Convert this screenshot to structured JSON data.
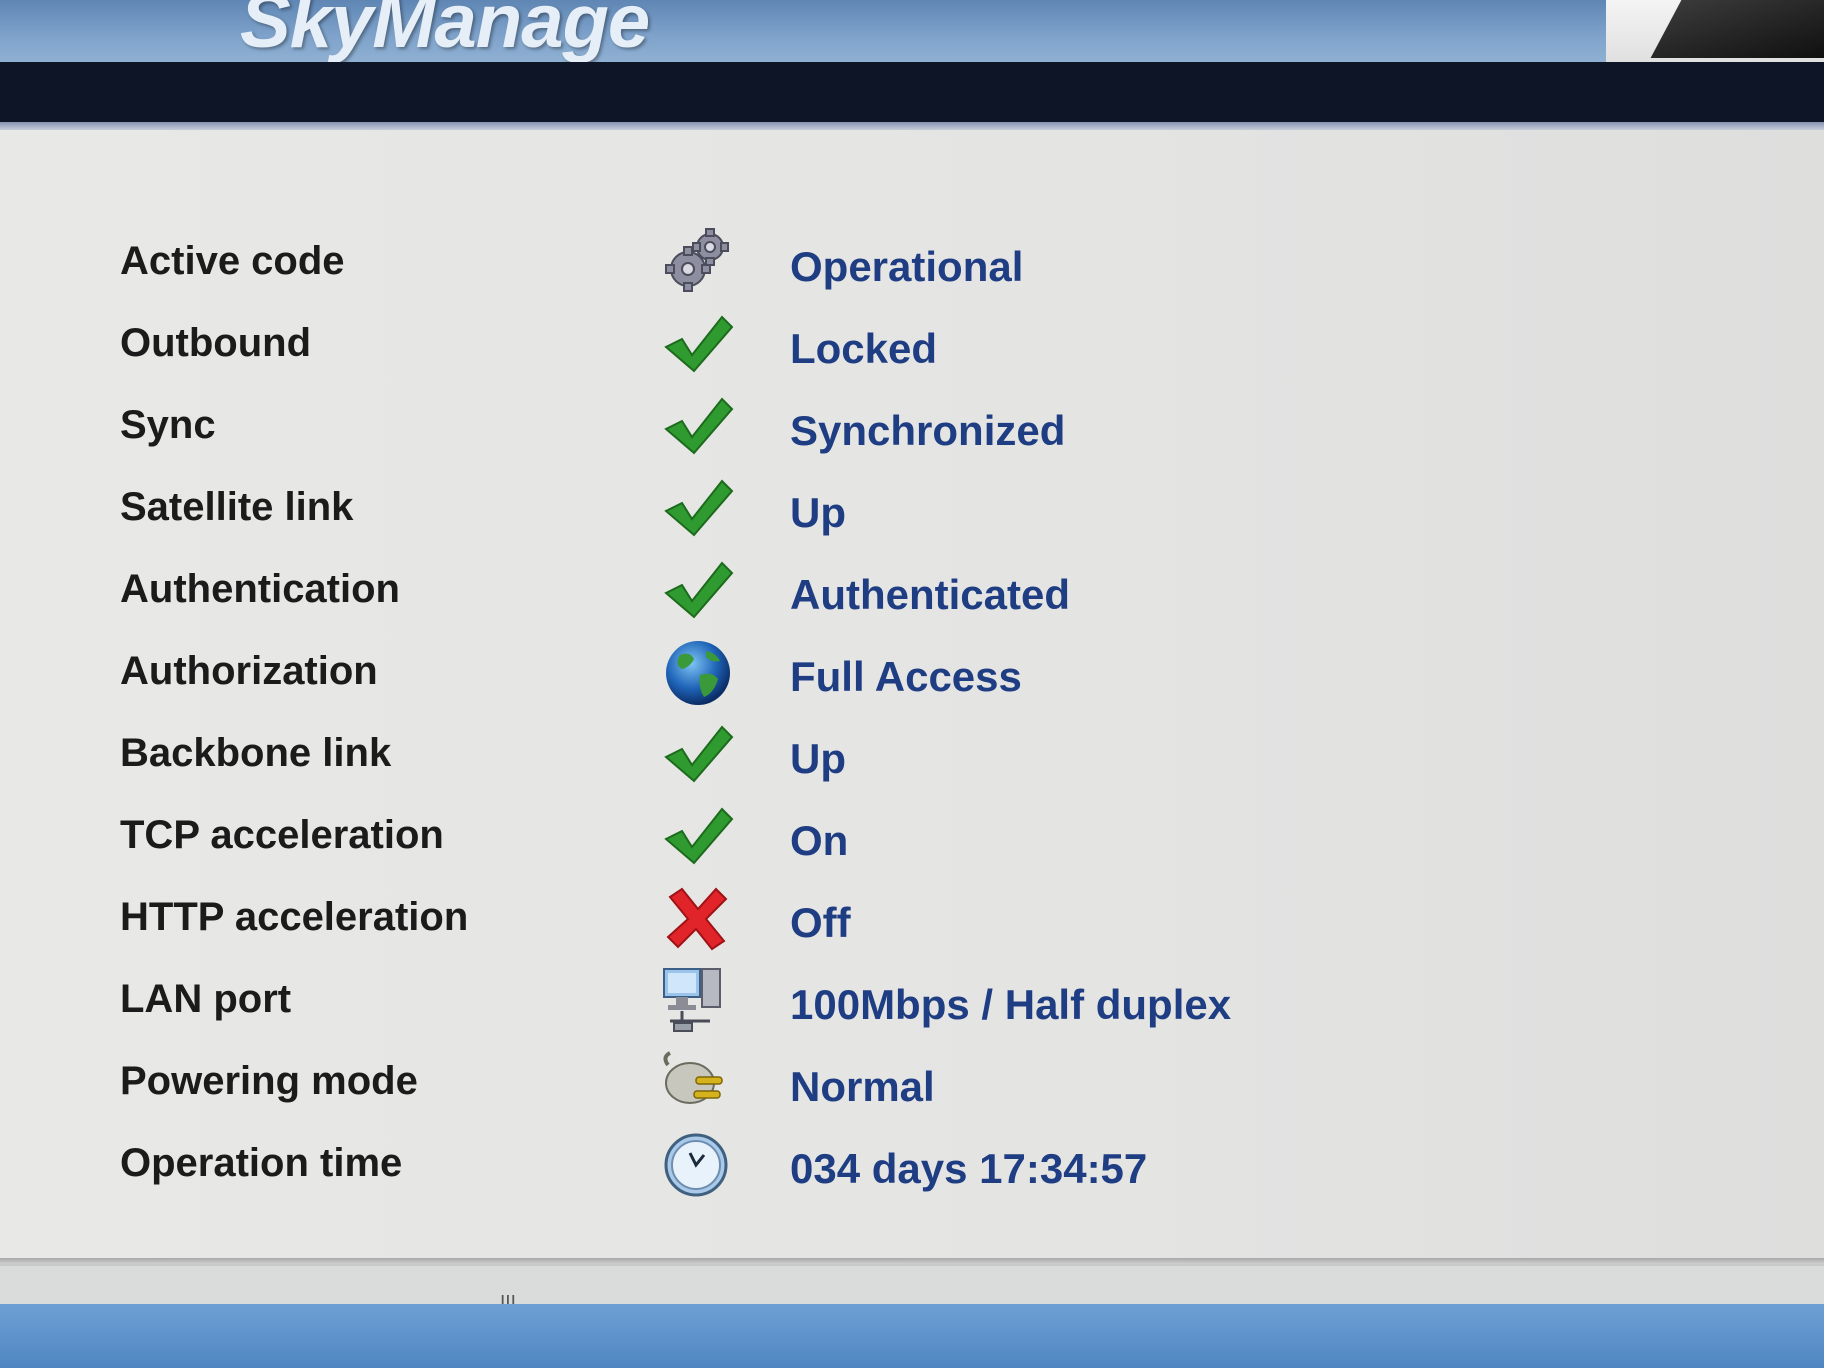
{
  "header": {
    "logo_text": "SkyManage"
  },
  "status_rows": [
    {
      "label": "Active code",
      "icon": "gears-icon",
      "value": "Operational"
    },
    {
      "label": "Outbound",
      "icon": "check-icon",
      "value": "Locked"
    },
    {
      "label": "Sync",
      "icon": "check-icon",
      "value": "Synchronized"
    },
    {
      "label": "Satellite link",
      "icon": "check-icon",
      "value": "Up"
    },
    {
      "label": "Authentication",
      "icon": "check-icon",
      "value": "Authenticated"
    },
    {
      "label": "Authorization",
      "icon": "globe-icon",
      "value": "Full Access"
    },
    {
      "label": "Backbone link",
      "icon": "check-icon",
      "value": "Up"
    },
    {
      "label": "TCP acceleration",
      "icon": "check-icon",
      "value": "On"
    },
    {
      "label": "HTTP acceleration",
      "icon": "cross-icon",
      "value": "Off"
    },
    {
      "label": "LAN port",
      "icon": "network-computer-icon",
      "value": "100Mbps / Half duplex"
    },
    {
      "label": "Powering mode",
      "icon": "power-plug-icon",
      "value": "Normal"
    },
    {
      "label": "Operation time",
      "icon": "clock-icon",
      "value": "034 days 17:34:57"
    }
  ],
  "colors": {
    "value_text": "#1f3d83",
    "label_text": "#1b1b1b",
    "check_green": "#2f9a2f",
    "cross_red": "#e0242a",
    "navbar": "#0d1526"
  },
  "scrollbar": {
    "grip": "III"
  }
}
